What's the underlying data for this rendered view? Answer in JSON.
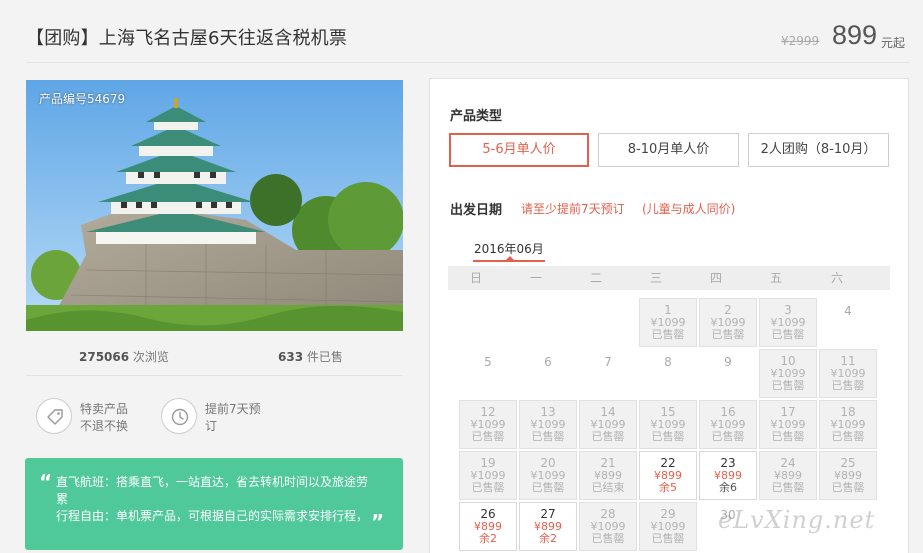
{
  "header": {
    "title": "【团购】上海飞名古屋6天往返含税机票",
    "price_old": "¥2999",
    "price_new": "899",
    "price_unit": "元起"
  },
  "photo": {
    "code": "产品编号54679"
  },
  "stats": {
    "views_num": "275066",
    "views_label": " 次浏览",
    "sold_num": "633",
    "sold_label": " 件已售"
  },
  "features": [
    {
      "icon": "tag-icon",
      "line1": "特卖产品",
      "line2": "不退不换"
    },
    {
      "icon": "clock-icon",
      "line1": "提前7天预",
      "line2": "订"
    }
  ],
  "highlight": {
    "line1": "直飞航班：搭乘直飞，一站直达，省去转机时间以及旅途劳累",
    "line2": "行程自由：单机票产品，可根据自己的实际需求安排行程，"
  },
  "booking": {
    "type_label": "产品类型",
    "types": [
      "5-6月单人价",
      "8-10月单人价",
      "2人团购（8-10月）"
    ],
    "active_type": 0,
    "date_label": "出发日期",
    "tip1": "请至少提前7天预订",
    "tip2": "(儿童与成人同价)",
    "month": "2016年06月",
    "weekdays": [
      "日",
      "一",
      "二",
      "三",
      "四",
      "五",
      "六"
    ],
    "days": [
      {
        "d": "1",
        "price": "¥1099",
        "status": "已售罄",
        "state": "sold"
      },
      {
        "d": "2",
        "price": "¥1099",
        "status": "已售罄",
        "state": "sold"
      },
      {
        "d": "3",
        "price": "¥1099",
        "status": "已售罄",
        "state": "sold"
      },
      {
        "d": "4",
        "price": "",
        "status": "",
        "state": "plain"
      },
      {
        "d": "5",
        "price": "",
        "status": "",
        "state": "plain"
      },
      {
        "d": "6",
        "price": "",
        "status": "",
        "state": "plain"
      },
      {
        "d": "7",
        "price": "",
        "status": "",
        "state": "plain"
      },
      {
        "d": "8",
        "price": "",
        "status": "",
        "state": "plain"
      },
      {
        "d": "9",
        "price": "",
        "status": "",
        "state": "plain"
      },
      {
        "d": "10",
        "price": "¥1099",
        "status": "已售罄",
        "state": "sold"
      },
      {
        "d": "11",
        "price": "¥1099",
        "status": "已售罄",
        "state": "sold"
      },
      {
        "d": "12",
        "price": "¥1099",
        "status": "已售罄",
        "state": "sold"
      },
      {
        "d": "13",
        "price": "¥1099",
        "status": "已售罄",
        "state": "sold"
      },
      {
        "d": "14",
        "price": "¥1099",
        "status": "已售罄",
        "state": "sold"
      },
      {
        "d": "15",
        "price": "¥1099",
        "status": "已售罄",
        "state": "sold"
      },
      {
        "d": "16",
        "price": "¥1099",
        "status": "已售罄",
        "state": "sold"
      },
      {
        "d": "17",
        "price": "¥1099",
        "status": "已售罄",
        "state": "sold"
      },
      {
        "d": "18",
        "price": "¥1099",
        "status": "已售罄",
        "state": "sold"
      },
      {
        "d": "19",
        "price": "¥1099",
        "status": "已售罄",
        "state": "sold"
      },
      {
        "d": "20",
        "price": "¥1099",
        "status": "已售罄",
        "state": "sold"
      },
      {
        "d": "21",
        "price": "¥899",
        "status": "已结束",
        "state": "sold"
      },
      {
        "d": "22",
        "price": "¥899",
        "status": "余5",
        "state": "avail"
      },
      {
        "d": "23",
        "price": "¥899",
        "status": "余6",
        "state": "avail-dark"
      },
      {
        "d": "24",
        "price": "¥899",
        "status": "已售罄",
        "state": "sold"
      },
      {
        "d": "25",
        "price": "¥899",
        "status": "已售罄",
        "state": "sold"
      },
      {
        "d": "26",
        "price": "¥899",
        "status": "余2",
        "state": "avail"
      },
      {
        "d": "27",
        "price": "¥899",
        "status": "余2",
        "state": "avail"
      },
      {
        "d": "28",
        "price": "¥1099",
        "status": "已售罄",
        "state": "sold"
      },
      {
        "d": "29",
        "price": "¥1099",
        "status": "已售罄",
        "state": "sold"
      },
      {
        "d": "30",
        "price": "",
        "status": "",
        "state": "plain"
      }
    ],
    "first_weekday": 3
  },
  "watermark": "eLvXing.net"
}
